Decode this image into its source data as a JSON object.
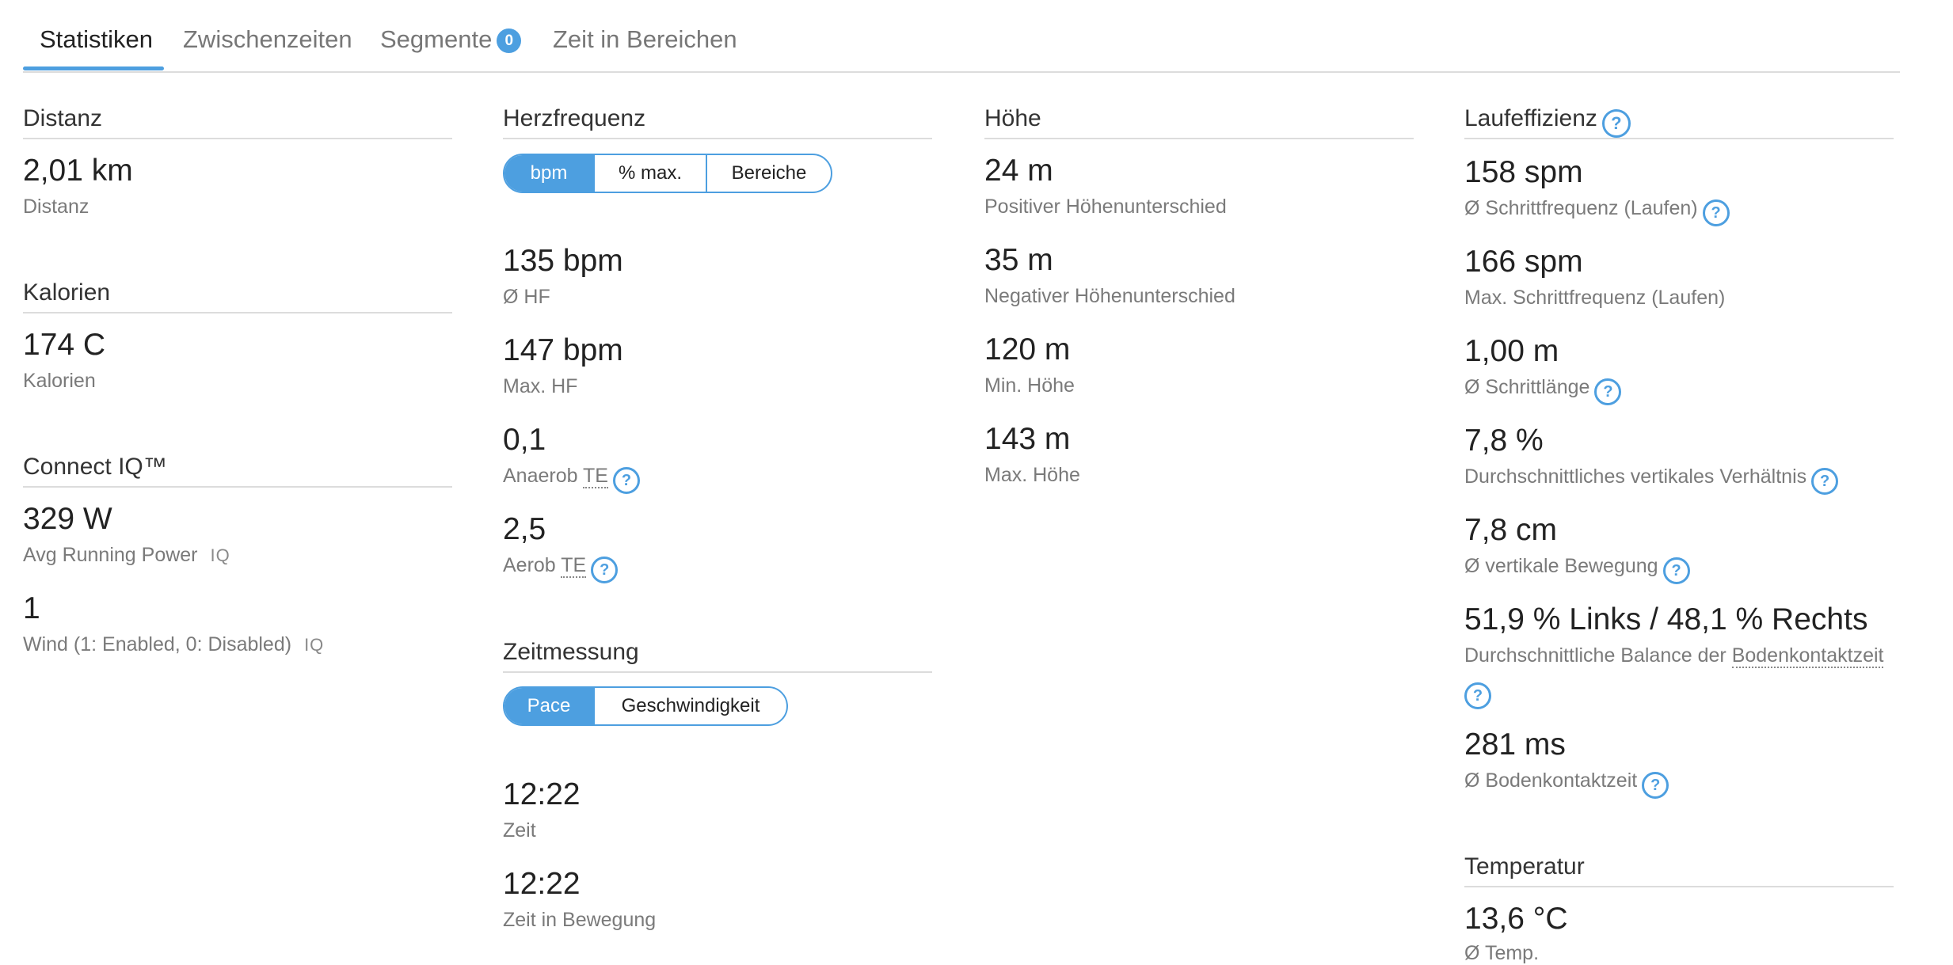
{
  "tabs": [
    {
      "label": "Statistiken"
    },
    {
      "label": "Zwischenzeiten"
    },
    {
      "label": "Segmente",
      "badge": "0"
    },
    {
      "label": "Zeit in Bereichen"
    }
  ],
  "help_glyph": "?",
  "iq_badge": "IQ",
  "distance": {
    "title": "Distanz",
    "value": "2,01 km",
    "label": "Distanz"
  },
  "calories": {
    "title": "Kalorien",
    "value": "174 C",
    "label": "Kalorien"
  },
  "connect_iq": {
    "title": "Connect IQ™",
    "items": [
      {
        "value": "329 W",
        "label": "Avg Running Power"
      },
      {
        "value": "1",
        "label": "Wind (1: Enabled, 0: Disabled)"
      }
    ]
  },
  "heart_rate": {
    "title": "Herzfrequenz",
    "toggle": [
      "bpm",
      "% max.",
      "Bereiche"
    ],
    "items": [
      {
        "value": "135 bpm",
        "label": "Ø HF"
      },
      {
        "value": "147 bpm",
        "label": "Max. HF"
      },
      {
        "value": "0,1",
        "label": "Anaerob",
        "abbr": "TE"
      },
      {
        "value": "2,5",
        "label": "Aerob",
        "abbr": "TE"
      }
    ]
  },
  "timing": {
    "title": "Zeitmessung",
    "toggle": [
      "Pace",
      "Geschwindigkeit"
    ],
    "items": [
      {
        "value": "12:22",
        "label": "Zeit"
      },
      {
        "value": "12:22",
        "label": "Zeit in Bewegung"
      }
    ]
  },
  "elevation": {
    "title": "Höhe",
    "items": [
      {
        "value": "24 m",
        "label": "Positiver Höhenunterschied"
      },
      {
        "value": "35 m",
        "label": "Negativer Höhenunterschied"
      },
      {
        "value": "120 m",
        "label": "Min. Höhe"
      },
      {
        "value": "143 m",
        "label": "Max. Höhe"
      }
    ]
  },
  "running_dynamics": {
    "title": "Laufeffizienz",
    "items": [
      {
        "value": "158 spm",
        "label": "Ø Schrittfrequenz (Laufen)"
      },
      {
        "value": "166 spm",
        "label": "Max. Schrittfrequenz (Laufen)"
      },
      {
        "value": "1,00 m",
        "label": "Ø Schrittlänge"
      },
      {
        "value": "7,8 %",
        "label": "Durchschnittliches vertikales Verhältnis"
      },
      {
        "value": "7,8 cm",
        "label": "Ø vertikale Bewegung"
      },
      {
        "value": "51,9 % Links / 48,1 % Rechts",
        "label": "Durchschnittliche Balance der",
        "label_link": "Bodenkontaktzeit"
      },
      {
        "value": "281 ms",
        "label": "Ø Bodenkontaktzeit"
      }
    ]
  },
  "temperature": {
    "title": "Temperatur",
    "value": "13,6 °C",
    "label": "Ø Temp."
  }
}
